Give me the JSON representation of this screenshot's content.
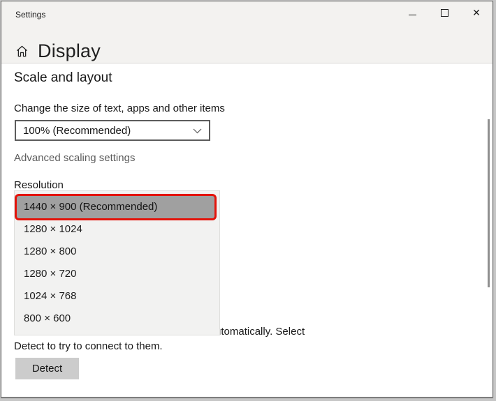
{
  "window": {
    "title": "Settings",
    "page_title": "Display",
    "icons": {
      "home": "home-icon",
      "minimize": "minimize-icon",
      "maximize": "maximize-icon",
      "close_glyph": "✕"
    }
  },
  "scale_section": {
    "heading": "Scale and layout",
    "size_label": "Change the size of text, apps and other items",
    "size_value": "100% (Recommended)",
    "advanced_link": "Advanced scaling settings"
  },
  "resolution": {
    "label": "Resolution",
    "selected_value": "1440 × 900 (Recommended)",
    "options": [
      {
        "label": "1440 × 900 (Recommended)",
        "selected": true
      },
      {
        "label": "1280 × 1024",
        "selected": false
      },
      {
        "label": "1280 × 800",
        "selected": false
      },
      {
        "label": "1280 × 720",
        "selected": false
      },
      {
        "label": "1024 × 768",
        "selected": false
      },
      {
        "label": "800 × 600",
        "selected": false
      }
    ],
    "annotation_color": "#e3130a",
    "highlight_color": "#a0a0a0"
  },
  "detect_section": {
    "visible_fragment": "utomatically. Select",
    "line2": "Detect to try to connect to them.",
    "button_label": "Detect"
  },
  "colors": {
    "header_bg": "#f3f2f0",
    "content_bg": "#ffffff",
    "flyout_bg": "#f2f2f1",
    "button_bg": "#cccccc",
    "link_gray": "#5d5d5d"
  }
}
